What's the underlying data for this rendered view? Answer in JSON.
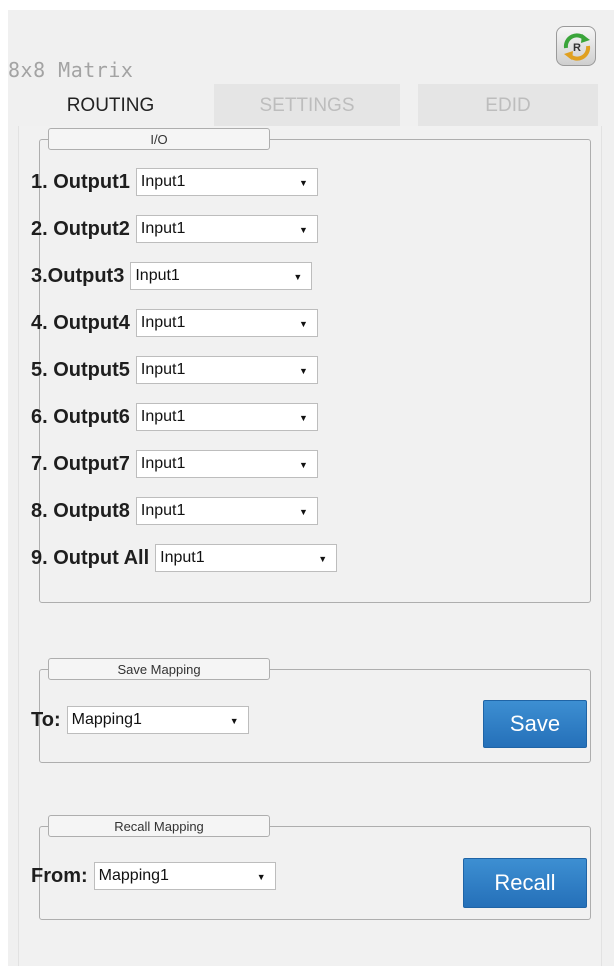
{
  "app": {
    "title": "8x8 Matrix",
    "refresh_button_letter": "R"
  },
  "tabs": [
    {
      "label": "ROUTING",
      "active": true
    },
    {
      "label": "SETTINGS",
      "active": false
    },
    {
      "label": "EDID",
      "active": false
    }
  ],
  "io": {
    "legend": "I/O",
    "rows": [
      {
        "label": "1. Output1",
        "value": "Input1"
      },
      {
        "label": "2. Output2",
        "value": "Input1"
      },
      {
        "label": "3.Output3",
        "value": "Input1"
      },
      {
        "label": "4. Output4",
        "value": "Input1"
      },
      {
        "label": "5. Output5",
        "value": "Input1"
      },
      {
        "label": "6. Output6",
        "value": "Input1"
      },
      {
        "label": "7. Output7",
        "value": "Input1"
      },
      {
        "label": "8. Output8",
        "value": "Input1"
      },
      {
        "label": "9. Output All",
        "value": "Input1"
      }
    ]
  },
  "save_mapping": {
    "legend": "Save Mapping",
    "label": "To:",
    "value": "Mapping1",
    "button": "Save"
  },
  "recall_mapping": {
    "legend": "Recall Mapping",
    "label": "From:",
    "value": "Mapping1",
    "button": "Recall"
  },
  "colors": {
    "accent_button": "#2f7fc6",
    "tab_active_text": "#222222",
    "tab_inactive_text": "#bdbdbd",
    "app_title": "#a3a3a3"
  }
}
